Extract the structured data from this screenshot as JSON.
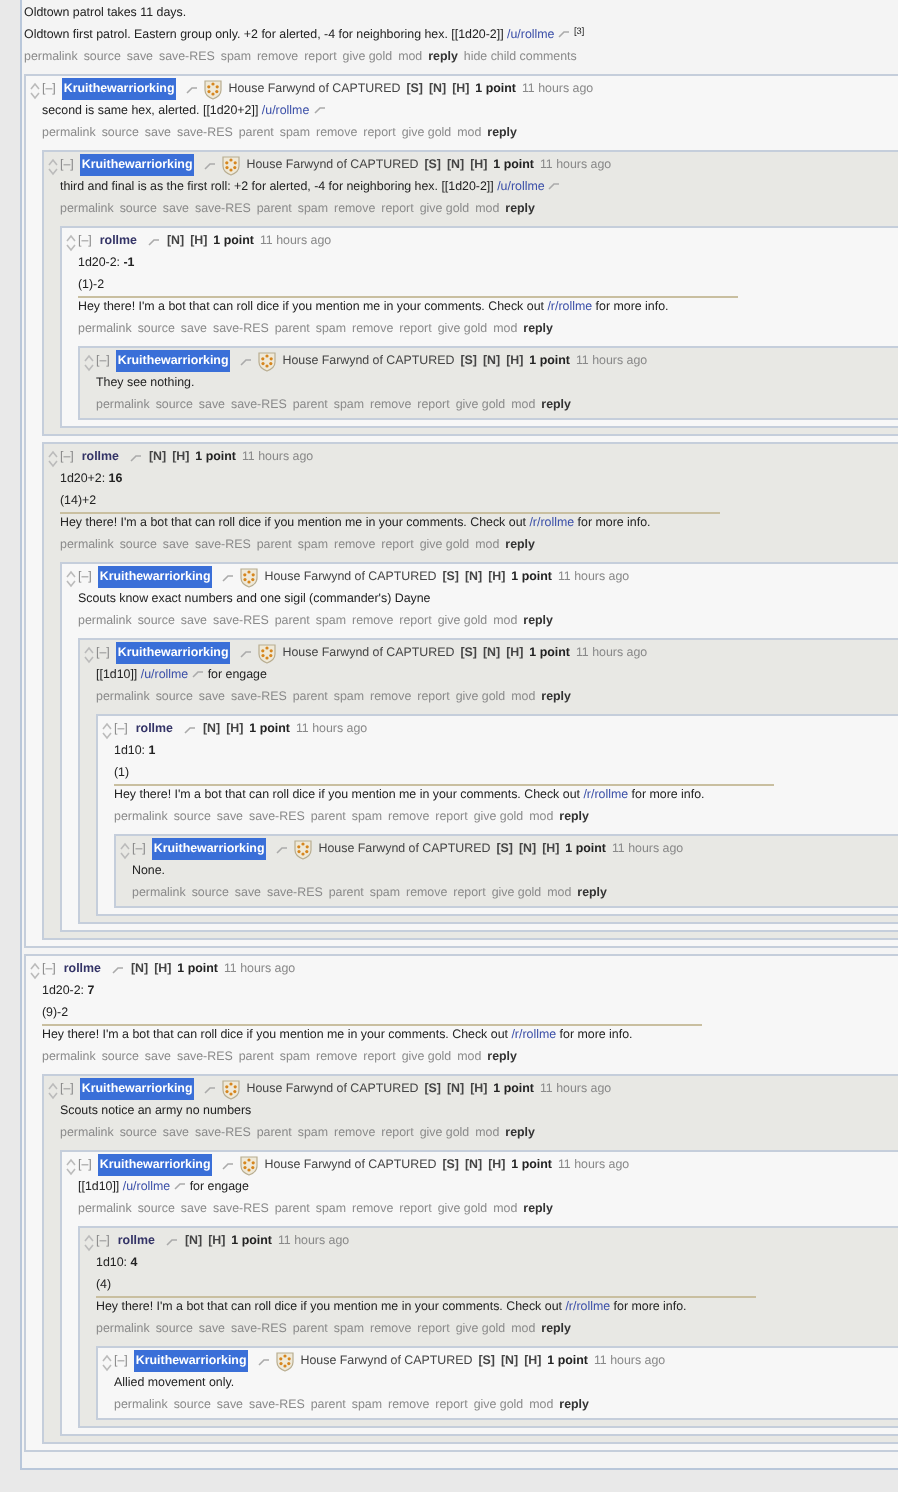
{
  "parent": {
    "body": [
      {
        "kind": "line",
        "parts": [
          {
            "kind": "text",
            "text": "Oldtown patrol takes 11 days."
          }
        ]
      },
      {
        "kind": "line",
        "parts": [
          {
            "kind": "text",
            "text": "Oldtown first patrol. Eastern group only. +2 for alerted, -4 for neighboring hex. [[1d20-2]] "
          },
          {
            "kind": "user",
            "text": "/u/rollme"
          },
          {
            "kind": "text",
            "text": " $^{[3]}$"
          }
        ]
      }
    ],
    "actions": [
      {
        "kind": "link",
        "label": "permalink"
      },
      {
        "kind": "link",
        "label": "source"
      },
      {
        "kind": "link",
        "label": "save"
      },
      {
        "kind": "link",
        "label": "save-RES"
      },
      {
        "kind": "link",
        "label": "spam"
      },
      {
        "kind": "link",
        "label": "remove"
      },
      {
        "kind": "link",
        "label": "report"
      },
      {
        "kind": "link",
        "label": "give gold"
      },
      {
        "kind": "link",
        "label": "mod"
      },
      {
        "kind": "reply",
        "label": "reply"
      },
      {
        "kind": "link",
        "label": "hide child comments"
      }
    ]
  },
  "comments": [
    {
      "collapse": "[–]",
      "author": "Kruithewarriorking",
      "highlighted": true,
      "flair": "House Farwynd of CAPTURED",
      "badges": [
        "[S]",
        "[N]",
        "[H]"
      ],
      "score": "1 point",
      "time": "11 hours ago",
      "body": [
        {
          "kind": "line",
          "parts": [
            {
              "kind": "text",
              "text": "second is same hex, alerted. [[1d20+2]] "
            },
            {
              "kind": "user",
              "text": "/u/rollme"
            }
          ]
        }
      ],
      "actions": [
        {
          "kind": "link",
          "label": "permalink"
        },
        {
          "kind": "link",
          "label": "source"
        },
        {
          "kind": "link",
          "label": "save"
        },
        {
          "kind": "link",
          "label": "save-RES"
        },
        {
          "kind": "link",
          "label": "parent"
        },
        {
          "kind": "link",
          "label": "spam"
        },
        {
          "kind": "link",
          "label": "remove"
        },
        {
          "kind": "link",
          "label": "report"
        },
        {
          "kind": "link",
          "label": "give gold"
        },
        {
          "kind": "link",
          "label": "mod"
        },
        {
          "kind": "reply",
          "label": "reply"
        }
      ],
      "children": [
        {
          "collapse": "[–]",
          "author": "Kruithewarriorking",
          "highlighted": true,
          "flair": "House Farwynd of CAPTURED",
          "badges": [
            "[S]",
            "[N]",
            "[H]"
          ],
          "score": "1 point",
          "time": "11 hours ago",
          "body": [
            {
              "kind": "line",
              "parts": [
                {
                  "kind": "text",
                  "text": "third and final is as the first roll: +2 for alerted, -4 for neighboring hex. [[1d20-2]] "
                },
                {
                  "kind": "user",
                  "text": "/u/rollme"
                }
              ]
            }
          ],
          "actions": [
            {
              "kind": "link",
              "label": "permalink"
            },
            {
              "kind": "link",
              "label": "source"
            },
            {
              "kind": "link",
              "label": "save"
            },
            {
              "kind": "link",
              "label": "save-RES"
            },
            {
              "kind": "link",
              "label": "parent"
            },
            {
              "kind": "link",
              "label": "spam"
            },
            {
              "kind": "link",
              "label": "remove"
            },
            {
              "kind": "link",
              "label": "report"
            },
            {
              "kind": "link",
              "label": "give gold"
            },
            {
              "kind": "link",
              "label": "mod"
            },
            {
              "kind": "reply",
              "label": "reply"
            }
          ],
          "children": [
            {
              "collapse": "[–]",
              "author": "rollme",
              "highlighted": false,
              "badges": [
                "[N]",
                "[H]"
              ],
              "score": "1 point",
              "time": "11 hours ago",
              "body": [
                {
                  "kind": "line",
                  "parts": [
                    {
                      "kind": "text",
                      "text": "1d20-2: **-1**"
                    }
                  ]
                },
                {
                  "kind": "line",
                  "parts": [
                    {
                      "kind": "text",
                      "text": "(1)-2"
                    }
                  ]
                },
                {
                  "kind": "rule"
                },
                {
                  "kind": "line",
                  "parts": [
                    {
                      "kind": "text",
                      "text": "Hey there! I'm a bot that can roll dice if you mention me in your comments. Check out "
                    },
                    {
                      "kind": "sub",
                      "text": "/r/rollme"
                    },
                    {
                      "kind": "text",
                      "text": " for more info."
                    }
                  ]
                }
              ],
              "actions": [
                {
                  "kind": "link",
                  "label": "permalink"
                },
                {
                  "kind": "link",
                  "label": "source"
                },
                {
                  "kind": "link",
                  "label": "save"
                },
                {
                  "kind": "link",
                  "label": "save-RES"
                },
                {
                  "kind": "link",
                  "label": "parent"
                },
                {
                  "kind": "link",
                  "label": "spam"
                },
                {
                  "kind": "link",
                  "label": "remove"
                },
                {
                  "kind": "link",
                  "label": "report"
                },
                {
                  "kind": "link",
                  "label": "give gold"
                },
                {
                  "kind": "link",
                  "label": "mod"
                },
                {
                  "kind": "reply",
                  "label": "reply"
                }
              ],
              "children": [
                {
                  "collapse": "[–]",
                  "author": "Kruithewarriorking",
                  "highlighted": true,
                  "flair": "House Farwynd of CAPTURED",
                  "badges": [
                    "[S]",
                    "[N]",
                    "[H]"
                  ],
                  "score": "1 point",
                  "time": "11 hours ago",
                  "body": [
                    {
                      "kind": "line",
                      "parts": [
                        {
                          "kind": "text",
                          "text": "They see nothing."
                        }
                      ]
                    }
                  ],
                  "actions": [
                    {
                      "kind": "link",
                      "label": "permalink"
                    },
                    {
                      "kind": "link",
                      "label": "source"
                    },
                    {
                      "kind": "link",
                      "label": "save"
                    },
                    {
                      "kind": "link",
                      "label": "save-RES"
                    },
                    {
                      "kind": "link",
                      "label": "parent"
                    },
                    {
                      "kind": "link",
                      "label": "spam"
                    },
                    {
                      "kind": "link",
                      "label": "remove"
                    },
                    {
                      "kind": "link",
                      "label": "report"
                    },
                    {
                      "kind": "link",
                      "label": "give gold"
                    },
                    {
                      "kind": "link",
                      "label": "mod"
                    },
                    {
                      "kind": "reply",
                      "label": "reply"
                    }
                  ]
                }
              ]
            }
          ]
        },
        {
          "collapse": "[–]",
          "author": "rollme",
          "highlighted": false,
          "badges": [
            "[N]",
            "[H]"
          ],
          "score": "1 point",
          "time": "11 hours ago",
          "body": [
            {
              "kind": "line",
              "parts": [
                {
                  "kind": "text",
                  "text": "1d20+2: **16**"
                }
              ]
            },
            {
              "kind": "line",
              "parts": [
                {
                  "kind": "text",
                  "text": "(14)+2"
                }
              ]
            },
            {
              "kind": "rule"
            },
            {
              "kind": "line",
              "parts": [
                {
                  "kind": "text",
                  "text": "Hey there! I'm a bot that can roll dice if you mention me in your comments. Check out "
                },
                {
                  "kind": "sub",
                  "text": "/r/rollme"
                },
                {
                  "kind": "text",
                  "text": " for more info."
                }
              ]
            }
          ],
          "actions": [
            {
              "kind": "link",
              "label": "permalink"
            },
            {
              "kind": "link",
              "label": "source"
            },
            {
              "kind": "link",
              "label": "save"
            },
            {
              "kind": "link",
              "label": "save-RES"
            },
            {
              "kind": "link",
              "label": "parent"
            },
            {
              "kind": "link",
              "label": "spam"
            },
            {
              "kind": "link",
              "label": "remove"
            },
            {
              "kind": "link",
              "label": "report"
            },
            {
              "kind": "link",
              "label": "give gold"
            },
            {
              "kind": "link",
              "label": "mod"
            },
            {
              "kind": "reply",
              "label": "reply"
            }
          ],
          "children": [
            {
              "collapse": "[–]",
              "author": "Kruithewarriorking",
              "highlighted": true,
              "flair": "House Farwynd of CAPTURED",
              "badges": [
                "[S]",
                "[N]",
                "[H]"
              ],
              "score": "1 point",
              "time": "11 hours ago",
              "body": [
                {
                  "kind": "line",
                  "parts": [
                    {
                      "kind": "text",
                      "text": "Scouts know exact numbers and one sigil (commander's) Dayne"
                    }
                  ]
                }
              ],
              "actions": [
                {
                  "kind": "link",
                  "label": "permalink"
                },
                {
                  "kind": "link",
                  "label": "source"
                },
                {
                  "kind": "link",
                  "label": "save"
                },
                {
                  "kind": "link",
                  "label": "save-RES"
                },
                {
                  "kind": "link",
                  "label": "parent"
                },
                {
                  "kind": "link",
                  "label": "spam"
                },
                {
                  "kind": "link",
                  "label": "remove"
                },
                {
                  "kind": "link",
                  "label": "report"
                },
                {
                  "kind": "link",
                  "label": "give gold"
                },
                {
                  "kind": "link",
                  "label": "mod"
                },
                {
                  "kind": "reply",
                  "label": "reply"
                }
              ],
              "children": [
                {
                  "collapse": "[–]",
                  "author": "Kruithewarriorking",
                  "highlighted": true,
                  "flair": "House Farwynd of CAPTURED",
                  "badges": [
                    "[S]",
                    "[N]",
                    "[H]"
                  ],
                  "score": "1 point",
                  "time": "11 hours ago",
                  "body": [
                    {
                      "kind": "line",
                      "parts": [
                        {
                          "kind": "text",
                          "text": "[[1d10]] "
                        },
                        {
                          "kind": "user",
                          "text": "/u/rollme"
                        },
                        {
                          "kind": "text",
                          "text": " for engage"
                        }
                      ]
                    }
                  ],
                  "actions": [
                    {
                      "kind": "link",
                      "label": "permalink"
                    },
                    {
                      "kind": "link",
                      "label": "source"
                    },
                    {
                      "kind": "link",
                      "label": "save"
                    },
                    {
                      "kind": "link",
                      "label": "save-RES"
                    },
                    {
                      "kind": "link",
                      "label": "parent"
                    },
                    {
                      "kind": "link",
                      "label": "spam"
                    },
                    {
                      "kind": "link",
                      "label": "remove"
                    },
                    {
                      "kind": "link",
                      "label": "report"
                    },
                    {
                      "kind": "link",
                      "label": "give gold"
                    },
                    {
                      "kind": "link",
                      "label": "mod"
                    },
                    {
                      "kind": "reply",
                      "label": "reply"
                    }
                  ],
                  "children": [
                    {
                      "collapse": "[–]",
                      "author": "rollme",
                      "highlighted": false,
                      "badges": [
                        "[N]",
                        "[H]"
                      ],
                      "score": "1 point",
                      "time": "11 hours ago",
                      "body": [
                        {
                          "kind": "line",
                          "parts": [
                            {
                              "kind": "text",
                              "text": "1d10: **1**"
                            }
                          ]
                        },
                        {
                          "kind": "line",
                          "parts": [
                            {
                              "kind": "text",
                              "text": "(1)"
                            }
                          ]
                        },
                        {
                          "kind": "rule"
                        },
                        {
                          "kind": "line",
                          "parts": [
                            {
                              "kind": "text",
                              "text": "Hey there! I'm a bot that can roll dice if you mention me in your comments. Check out "
                            },
                            {
                              "kind": "sub",
                              "text": "/r/rollme"
                            },
                            {
                              "kind": "text",
                              "text": " for more info."
                            }
                          ]
                        }
                      ],
                      "actions": [
                        {
                          "kind": "link",
                          "label": "permalink"
                        },
                        {
                          "kind": "link",
                          "label": "source"
                        },
                        {
                          "kind": "link",
                          "label": "save"
                        },
                        {
                          "kind": "link",
                          "label": "save-RES"
                        },
                        {
                          "kind": "link",
                          "label": "parent"
                        },
                        {
                          "kind": "link",
                          "label": "spam"
                        },
                        {
                          "kind": "link",
                          "label": "remove"
                        },
                        {
                          "kind": "link",
                          "label": "report"
                        },
                        {
                          "kind": "link",
                          "label": "give gold"
                        },
                        {
                          "kind": "link",
                          "label": "mod"
                        },
                        {
                          "kind": "reply",
                          "label": "reply"
                        }
                      ],
                      "children": [
                        {
                          "collapse": "[–]",
                          "author": "Kruithewarriorking",
                          "highlighted": true,
                          "flair": "House Farwynd of CAPTURED",
                          "badges": [
                            "[S]",
                            "[N]",
                            "[H]"
                          ],
                          "score": "1 point",
                          "time": "11 hours ago",
                          "body": [
                            {
                              "kind": "line",
                              "parts": [
                                {
                                  "kind": "text",
                                  "text": "None."
                                }
                              ]
                            }
                          ],
                          "actions": [
                            {
                              "kind": "link",
                              "label": "permalink"
                            },
                            {
                              "kind": "link",
                              "label": "source"
                            },
                            {
                              "kind": "link",
                              "label": "save"
                            },
                            {
                              "kind": "link",
                              "label": "save-RES"
                            },
                            {
                              "kind": "link",
                              "label": "parent"
                            },
                            {
                              "kind": "link",
                              "label": "spam"
                            },
                            {
                              "kind": "link",
                              "label": "remove"
                            },
                            {
                              "kind": "link",
                              "label": "report"
                            },
                            {
                              "kind": "link",
                              "label": "give gold"
                            },
                            {
                              "kind": "link",
                              "label": "mod"
                            },
                            {
                              "kind": "reply",
                              "label": "reply"
                            }
                          ]
                        }
                      ]
                    }
                  ]
                }
              ]
            }
          ]
        }
      ]
    },
    {
      "collapse": "[–]",
      "author": "rollme",
      "highlighted": false,
      "badges": [
        "[N]",
        "[H]"
      ],
      "score": "1 point",
      "time": "11 hours ago",
      "body": [
        {
          "kind": "line",
          "parts": [
            {
              "kind": "text",
              "text": "1d20-2: **7**"
            }
          ]
        },
        {
          "kind": "line",
          "parts": [
            {
              "kind": "text",
              "text": "(9)-2"
            }
          ]
        },
        {
          "kind": "rule"
        },
        {
          "kind": "line",
          "parts": [
            {
              "kind": "text",
              "text": "Hey there! I'm a bot that can roll dice if you mention me in your comments. Check out "
            },
            {
              "kind": "sub",
              "text": "/r/rollme"
            },
            {
              "kind": "text",
              "text": " for more info."
            }
          ]
        }
      ],
      "actions": [
        {
          "kind": "link",
          "label": "permalink"
        },
        {
          "kind": "link",
          "label": "source"
        },
        {
          "kind": "link",
          "label": "save"
        },
        {
          "kind": "link",
          "label": "save-RES"
        },
        {
          "kind": "link",
          "label": "parent"
        },
        {
          "kind": "link",
          "label": "spam"
        },
        {
          "kind": "link",
          "label": "remove"
        },
        {
          "kind": "link",
          "label": "report"
        },
        {
          "kind": "link",
          "label": "give gold"
        },
        {
          "kind": "link",
          "label": "mod"
        },
        {
          "kind": "reply",
          "label": "reply"
        }
      ],
      "children": [
        {
          "collapse": "[–]",
          "author": "Kruithewarriorking",
          "highlighted": true,
          "flair": "House Farwynd of CAPTURED",
          "badges": [
            "[S]",
            "[N]",
            "[H]"
          ],
          "score": "1 point",
          "time": "11 hours ago",
          "body": [
            {
              "kind": "line",
              "parts": [
                {
                  "kind": "text",
                  "text": "Scouts notice an army no numbers"
                }
              ]
            }
          ],
          "actions": [
            {
              "kind": "link",
              "label": "permalink"
            },
            {
              "kind": "link",
              "label": "source"
            },
            {
              "kind": "link",
              "label": "save"
            },
            {
              "kind": "link",
              "label": "save-RES"
            },
            {
              "kind": "link",
              "label": "parent"
            },
            {
              "kind": "link",
              "label": "spam"
            },
            {
              "kind": "link",
              "label": "remove"
            },
            {
              "kind": "link",
              "label": "report"
            },
            {
              "kind": "link",
              "label": "give gold"
            },
            {
              "kind": "link",
              "label": "mod"
            },
            {
              "kind": "reply",
              "label": "reply"
            }
          ],
          "children": [
            {
              "collapse": "[–]",
              "author": "Kruithewarriorking",
              "highlighted": true,
              "flair": "House Farwynd of CAPTURED",
              "badges": [
                "[S]",
                "[N]",
                "[H]"
              ],
              "score": "1 point",
              "time": "11 hours ago",
              "body": [
                {
                  "kind": "line",
                  "parts": [
                    {
                      "kind": "text",
                      "text": "[[1d10]] "
                    },
                    {
                      "kind": "user",
                      "text": "/u/rollme"
                    },
                    {
                      "kind": "text",
                      "text": " for engage"
                    }
                  ]
                }
              ],
              "actions": [
                {
                  "kind": "link",
                  "label": "permalink"
                },
                {
                  "kind": "link",
                  "label": "source"
                },
                {
                  "kind": "link",
                  "label": "save"
                },
                {
                  "kind": "link",
                  "label": "save-RES"
                },
                {
                  "kind": "link",
                  "label": "parent"
                },
                {
                  "kind": "link",
                  "label": "spam"
                },
                {
                  "kind": "link",
                  "label": "remove"
                },
                {
                  "kind": "link",
                  "label": "report"
                },
                {
                  "kind": "link",
                  "label": "give gold"
                },
                {
                  "kind": "link",
                  "label": "mod"
                },
                {
                  "kind": "reply",
                  "label": "reply"
                }
              ],
              "children": [
                {
                  "collapse": "[–]",
                  "author": "rollme",
                  "highlighted": false,
                  "badges": [
                    "[N]",
                    "[H]"
                  ],
                  "score": "1 point",
                  "time": "11 hours ago",
                  "body": [
                    {
                      "kind": "line",
                      "parts": [
                        {
                          "kind": "text",
                          "text": "1d10: **4**"
                        }
                      ]
                    },
                    {
                      "kind": "line",
                      "parts": [
                        {
                          "kind": "text",
                          "text": "(4)"
                        }
                      ]
                    },
                    {
                      "kind": "rule"
                    },
                    {
                      "kind": "line",
                      "parts": [
                        {
                          "kind": "text",
                          "text": "Hey there! I'm a bot that can roll dice if you mention me in your comments. Check out "
                        },
                        {
                          "kind": "sub",
                          "text": "/r/rollme"
                        },
                        {
                          "kind": "text",
                          "text": " for more info."
                        }
                      ]
                    }
                  ],
                  "actions": [
                    {
                      "kind": "link",
                      "label": "permalink"
                    },
                    {
                      "kind": "link",
                      "label": "source"
                    },
                    {
                      "kind": "link",
                      "label": "save"
                    },
                    {
                      "kind": "link",
                      "label": "save-RES"
                    },
                    {
                      "kind": "link",
                      "label": "parent"
                    },
                    {
                      "kind": "link",
                      "label": "spam"
                    },
                    {
                      "kind": "link",
                      "label": "remove"
                    },
                    {
                      "kind": "link",
                      "label": "report"
                    },
                    {
                      "kind": "link",
                      "label": "give gold"
                    },
                    {
                      "kind": "link",
                      "label": "mod"
                    },
                    {
                      "kind": "reply",
                      "label": "reply"
                    }
                  ],
                  "children": [
                    {
                      "collapse": "[–]",
                      "author": "Kruithewarriorking",
                      "highlighted": true,
                      "flair": "House Farwynd of CAPTURED",
                      "badges": [
                        "[S]",
                        "[N]",
                        "[H]"
                      ],
                      "score": "1 point",
                      "time": "11 hours ago",
                      "body": [
                        {
                          "kind": "line",
                          "parts": [
                            {
                              "kind": "text",
                              "text": "Allied movement only."
                            }
                          ]
                        }
                      ],
                      "actions": [
                        {
                          "kind": "link",
                          "label": "permalink"
                        },
                        {
                          "kind": "link",
                          "label": "source"
                        },
                        {
                          "kind": "link",
                          "label": "save"
                        },
                        {
                          "kind": "link",
                          "label": "save-RES"
                        },
                        {
                          "kind": "link",
                          "label": "parent"
                        },
                        {
                          "kind": "link",
                          "label": "spam"
                        },
                        {
                          "kind": "link",
                          "label": "remove"
                        },
                        {
                          "kind": "link",
                          "label": "report"
                        },
                        {
                          "kind": "link",
                          "label": "give gold"
                        },
                        {
                          "kind": "link",
                          "label": "mod"
                        },
                        {
                          "kind": "reply",
                          "label": "reply"
                        }
                      ]
                    }
                  ]
                }
              ]
            }
          ]
        }
      ]
    }
  ]
}
